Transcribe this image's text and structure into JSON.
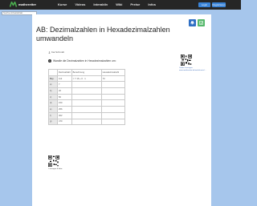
{
  "nav": {
    "logo_text": "matheretter",
    "links": [
      "Kurse",
      "Videos",
      "Interaktiv",
      "Wiki",
      "Preise",
      "Infos"
    ],
    "login": "Login",
    "register": "Registrieren"
  },
  "search": {
    "placeholder": "Suche Arbeitsblatt"
  },
  "worksheet": {
    "title": "AB: Dezimalzahlen in Hexadezimalzahlen umwandeln",
    "author": "Kai Schmidt",
    "task_number": "1",
    "task_text": "Wandle die Dezimalzahlen in Hexadezimalzahlen um:",
    "table": {
      "headers": [
        "",
        "Dezimalzahl",
        "Berechnung",
        "Hexadezimalzahl"
      ],
      "example": [
        "Bsp.",
        "112",
        "= 7·16 + 0 · 1",
        "70"
      ],
      "row_numbers": [
        "a)",
        "b)",
        "c)",
        "d)",
        "e)",
        "f)",
        "g)"
      ],
      "values": [
        "7",
        "20",
        "50",
        "150",
        "256",
        "402",
        "470"
      ]
    },
    "qr_top_label": "Online-Lösungen: www.matheretter.de/worksheets/...",
    "qr_bottom_label": "Lösungen & Infos"
  },
  "colors": {
    "page_bg": "#a6c6ec",
    "nav_bg": "#262626",
    "print_button": "#2f6fc4",
    "share_button": "#55b86b",
    "logo_green": "#4caf50"
  },
  "icons": {
    "print": "print-icon",
    "share": "share-icon",
    "author": "user-icon"
  }
}
